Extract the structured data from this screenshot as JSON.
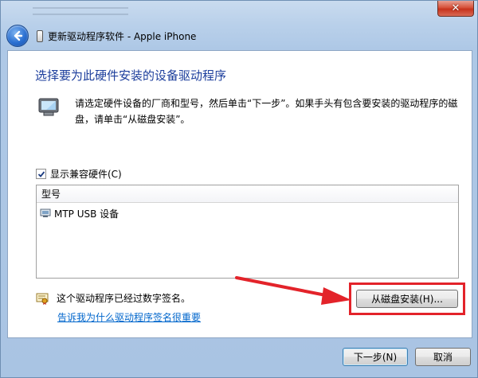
{
  "window": {
    "close_label": "✕",
    "title": "更新驱动程序软件 - Apple iPhone"
  },
  "content": {
    "heading": "选择要为此硬件安装的设备驱动程序",
    "instruction": "请选定硬件设备的厂商和型号，然后单击“下一步”。如果手头有包含要安装的驱动程序的磁盘，请单击“从磁盘安装”。",
    "show_compatible_label": "显示兼容硬件(C)",
    "show_compatible_checked": true,
    "list": {
      "header": "型号",
      "items": [
        "MTP USB 设备"
      ]
    },
    "signed_text": "这个驱动程序已经过数字签名。",
    "why_link": "告诉我为什么驱动程序签名很重要",
    "have_disk_button": "从磁盘安装(H)..."
  },
  "footer": {
    "next_button": "下一步(N)",
    "cancel_button": "取消"
  },
  "colors": {
    "heading": "#1c3e9c",
    "link": "#0066cc",
    "annotation": "#e3232a"
  },
  "icons": [
    "close-icon",
    "back-arrow-icon",
    "device-icon",
    "checkmark-icon",
    "usb-device-icon",
    "certificate-icon",
    "annotation-arrow"
  ]
}
